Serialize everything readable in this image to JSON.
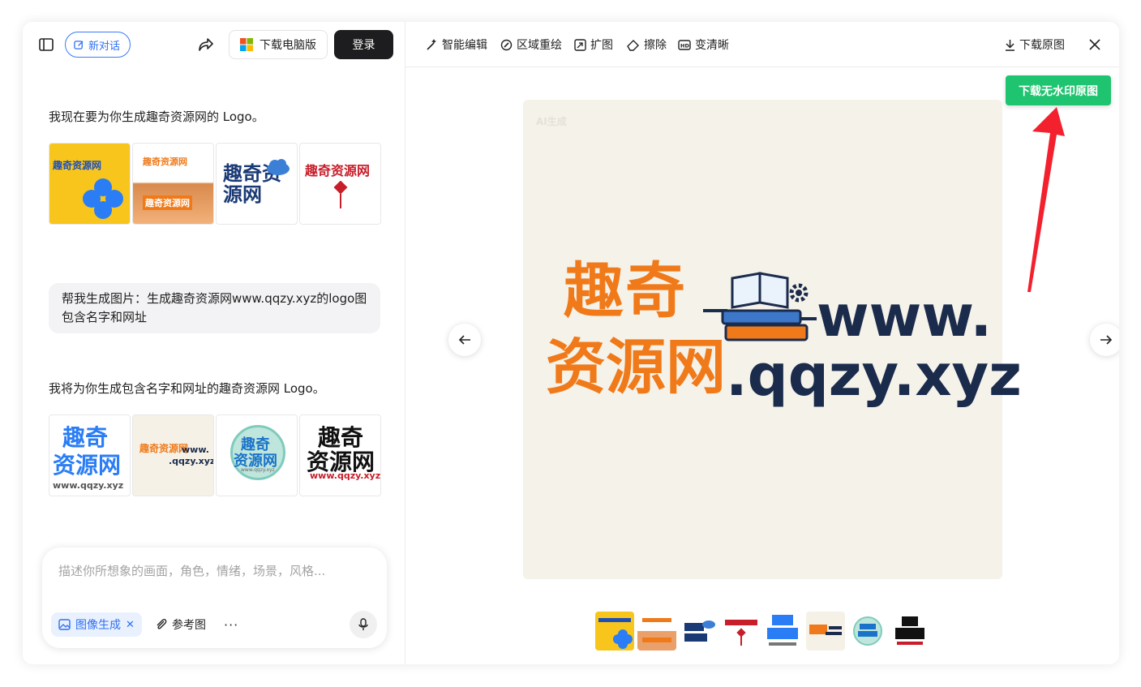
{
  "header": {
    "new_chat": "新对话",
    "download_pc": "下载电脑版",
    "login": "登录"
  },
  "chat": {
    "reply1": "我现在要为你生成趣奇资源网的 Logo。",
    "user_msg": "帮我生成图片：生成趣奇资源网www.qqzy.xyz的logo图包含名字和网址",
    "reply2": "我将为你生成包含名字和网址的趣奇资源网 Logo。"
  },
  "thumbs_row1": [
    {
      "text": "趣奇资源网",
      "style": "yellow"
    },
    {
      "text": "趣奇资源网",
      "style": "photo"
    },
    {
      "text": "趣奇资源网",
      "style": "cloud"
    },
    {
      "text": "趣奇资源网",
      "style": "knot"
    }
  ],
  "thumbs_row2": [
    {
      "line1": "趣奇",
      "line2": "资源网",
      "line3": "www.qqzy.xyz",
      "style": "blue"
    },
    {
      "line1": "趣奇资源网",
      "line2": "www.",
      "line3": ".qqzy.xyz",
      "style": "orange"
    },
    {
      "line1": "趣奇",
      "line2": "资源网",
      "line3": "www.qqzy.xyz",
      "style": "circle"
    },
    {
      "line1": "趣奇",
      "line2": "资源网",
      "line3": "www.qqzy.xyz",
      "style": "black"
    }
  ],
  "composer": {
    "placeholder": "描述你所想象的画面，角色，情绪，场景，风格...",
    "image_gen": "图像生成",
    "reference": "参考图",
    "more": "···"
  },
  "toolbar": {
    "smart_edit": "智能编辑",
    "region_redraw": "区域重绘",
    "expand": "扩图",
    "erase": "擦除",
    "hd": "变清晰",
    "download_original": "下载原图"
  },
  "download_no_watermark": "下载无水印原图",
  "preview": {
    "title_line1": "趣奇",
    "title_line2": "资源网",
    "url_line1": "www.",
    "url_line2": ".qqzy.xyz",
    "watermark": "AI生成"
  },
  "colors": {
    "accent_blue": "#2f6ff0",
    "green": "#1fc470",
    "orange": "#f07a1a",
    "navy": "#1a2b4c",
    "red_arrow": "#f3202e"
  }
}
